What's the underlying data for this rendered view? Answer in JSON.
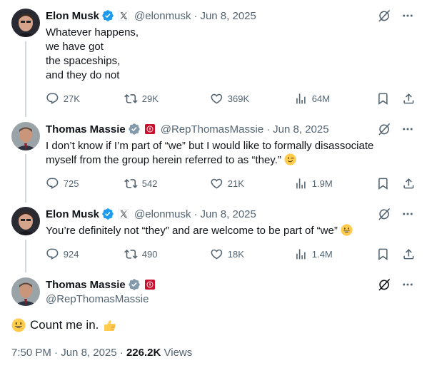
{
  "tweets": [
    {
      "name": "Elon Musk",
      "handle": "@elonmusk",
      "date": "Jun 8, 2025",
      "text_lines": [
        "Whatever happens,",
        "we have got",
        "the spaceships,",
        "and they do not"
      ],
      "replies": "27K",
      "reposts": "29K",
      "likes": "369K",
      "views": "64M"
    },
    {
      "name": "Thomas Massie",
      "handle": "@RepThomasMassie",
      "date": "Jun 8, 2025",
      "text_lines": [
        "I don’t know if I’m part of “we” but I would like to formally disassociate",
        "myself from the group herein referred to as “they.”"
      ],
      "replies": "725",
      "reposts": "542",
      "likes": "21K",
      "views": "1.9M"
    },
    {
      "name": "Elon Musk",
      "handle": "@elonmusk",
      "date": "Jun 8, 2025",
      "text_lines": [
        "You’re definitely not “they” and are welcome to be part of “we”"
      ],
      "replies": "924",
      "reposts": "490",
      "likes": "18K",
      "views": "1.4M"
    }
  ],
  "main": {
    "name": "Thomas Massie",
    "handle": "@RepThomasMassie",
    "text": "Count me in.",
    "time": "7:50 PM",
    "date": "Jun 8, 2025",
    "views_count": "226.2K",
    "views_label": "Views"
  },
  "separator": "·",
  "colors": {
    "verified_blue": "#1d9bf0",
    "verified_gray": "#829aab",
    "text": "#0f1419",
    "secondary": "#536471",
    "thread_line": "#cfd9de"
  },
  "icons": [
    "verified-badge-icon",
    "x-affiliation-icon",
    "house-seal-icon",
    "grok-icon",
    "more-icon",
    "reply-icon",
    "repost-icon",
    "like-icon",
    "views-icon",
    "bookmark-icon",
    "share-icon"
  ]
}
